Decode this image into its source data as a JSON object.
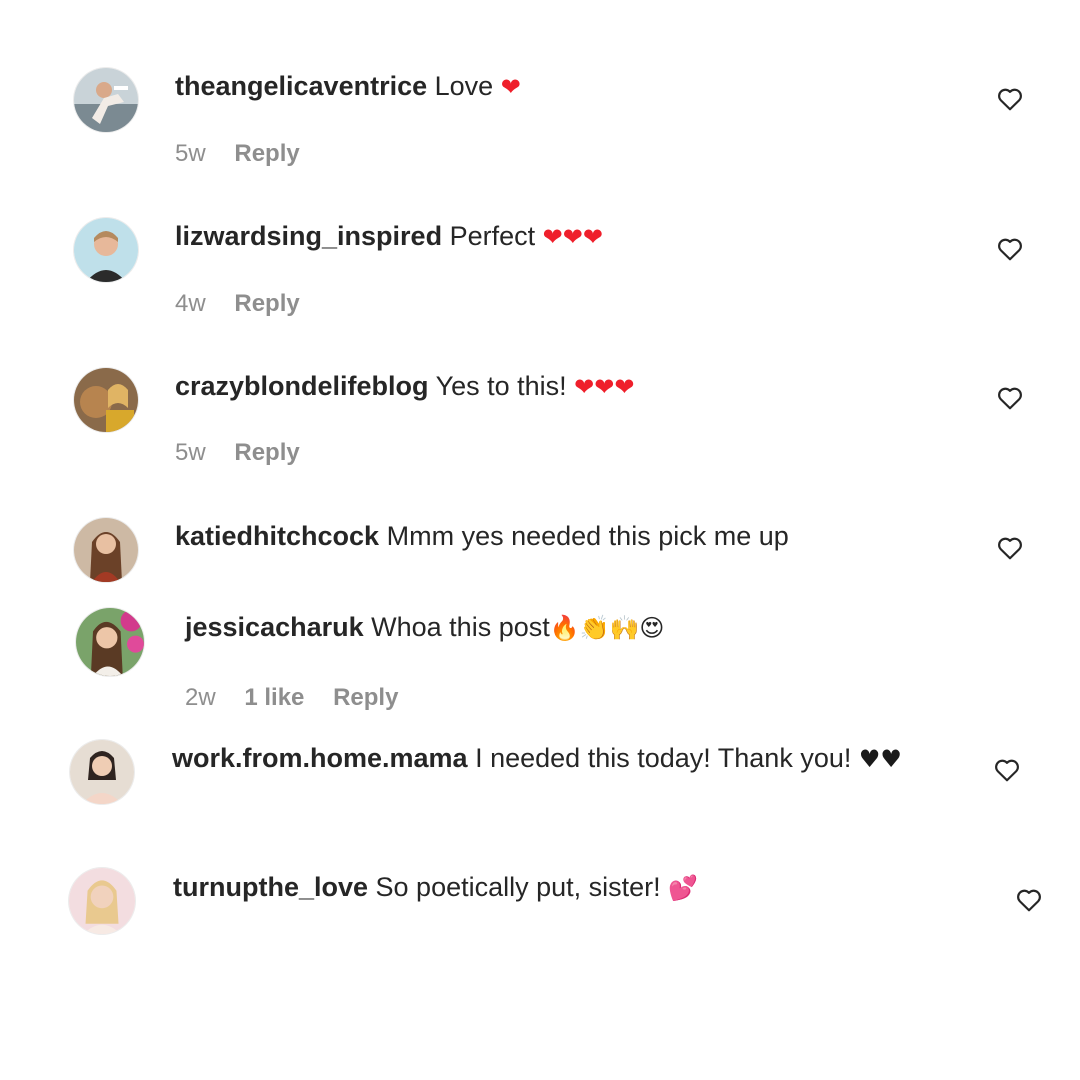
{
  "comments": [
    {
      "username": "theangelicaventrice",
      "text": "Love",
      "emoji": "❤",
      "time": "5w",
      "reply": "Reply"
    },
    {
      "username": "lizwardsing_inspired",
      "text": "Perfect",
      "emoji": "❤❤❤",
      "time": "4w",
      "reply": "Reply"
    },
    {
      "username": "crazyblondelifeblog",
      "text": "Yes to this!",
      "emoji": "❤❤❤",
      "time": "5w",
      "reply": "Reply"
    },
    {
      "username": "katiedhitchcock",
      "text": "Mmm yes needed this pick me up"
    },
    {
      "username": "jessicacharuk",
      "text": "Whoa this post",
      "emoji": "🔥👏🙌😍",
      "time": "2w",
      "likes": "1 like",
      "reply": "Reply"
    },
    {
      "username": "work.from.home.mama",
      "text": "I needed this today! Thank you!",
      "emoji": "♥♥"
    },
    {
      "username": "turnupthe_love",
      "text": "So poetically put, sister!",
      "emoji": "💕"
    }
  ],
  "colors": {
    "text": "#262626",
    "meta": "#8e8e8e",
    "heart_emoji": "#ef1f2b",
    "background": "#ffffff"
  },
  "icons": {
    "like": "heart-outline-icon"
  }
}
